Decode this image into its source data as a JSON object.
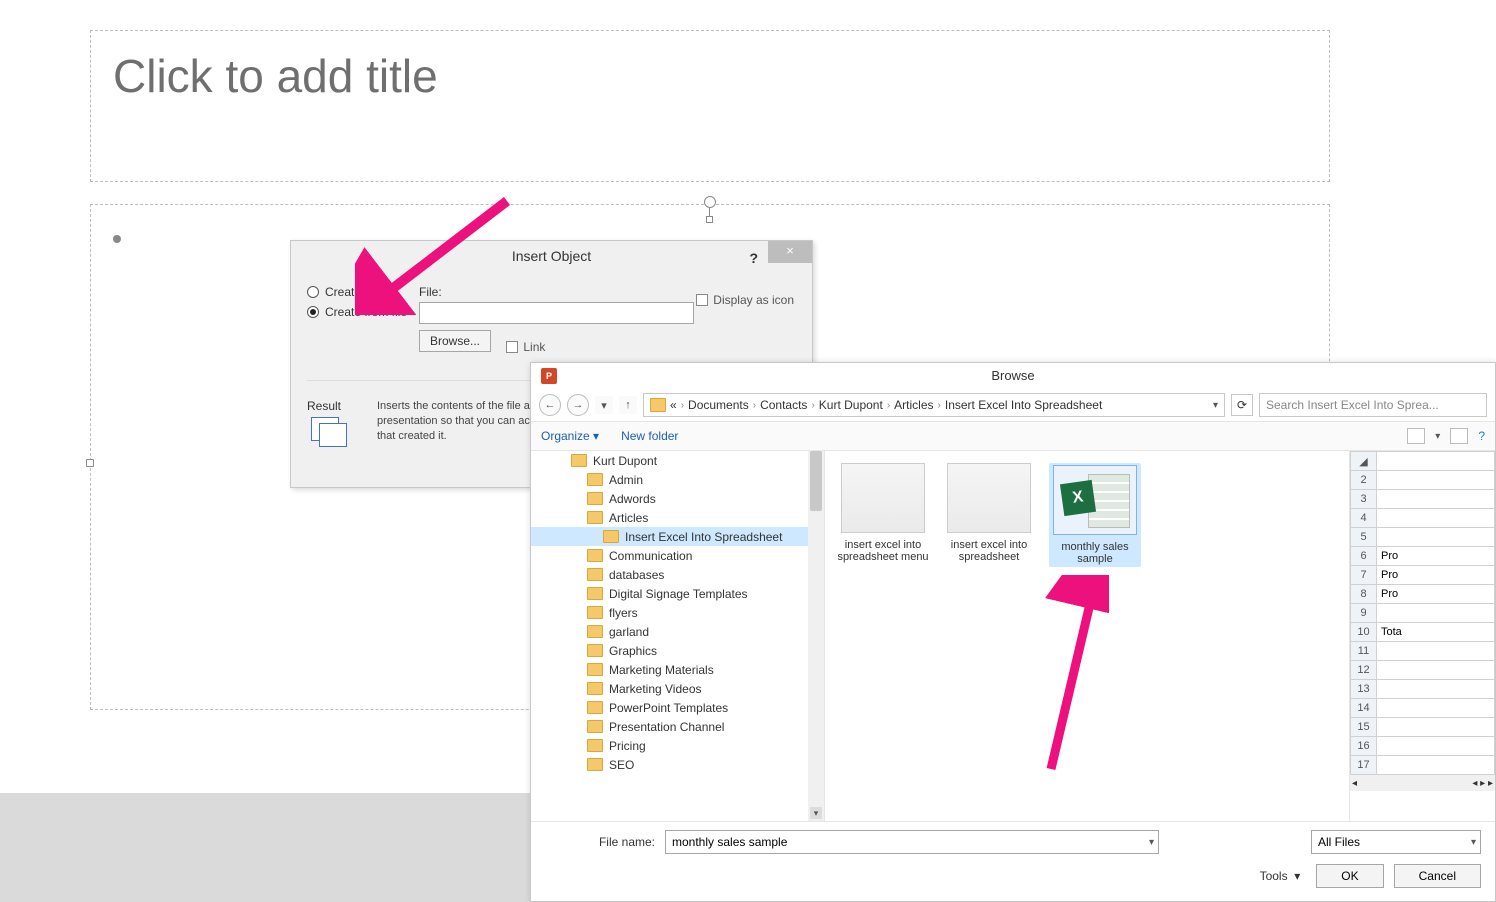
{
  "slide": {
    "title_placeholder": "Click to add title"
  },
  "insert_object": {
    "title": "Insert Object",
    "radio_new": "Create new",
    "radio_file": "Create from file",
    "file_label": "File:",
    "browse": "Browse...",
    "link": "Link",
    "display_icon": "Display as icon",
    "result_label": "Result",
    "result_desc": "Inserts the contents of the file as an object into your presentation so that you can activate it using the application that created it.",
    "help": "?",
    "close": "×"
  },
  "browse": {
    "title": "Browse",
    "ppt_badge": "P",
    "breadcrumb": [
      "«",
      "Documents",
      "Contacts",
      "Kurt Dupont",
      "Articles",
      "Insert Excel Into Spreadsheet"
    ],
    "search_placeholder": "Search Insert Excel Into Sprea...",
    "organize": "Organize",
    "new_folder": "New folder",
    "tree": [
      {
        "label": "Kurt Dupont",
        "indent": 40
      },
      {
        "label": "Admin",
        "indent": 56
      },
      {
        "label": "Adwords",
        "indent": 56
      },
      {
        "label": "Articles",
        "indent": 56
      },
      {
        "label": "Insert Excel Into Spreadsheet",
        "indent": 72,
        "selected": true
      },
      {
        "label": "Communication",
        "indent": 56
      },
      {
        "label": "databases",
        "indent": 56
      },
      {
        "label": "Digital Signage Templates",
        "indent": 56
      },
      {
        "label": "flyers",
        "indent": 56
      },
      {
        "label": "garland",
        "indent": 56
      },
      {
        "label": "Graphics",
        "indent": 56
      },
      {
        "label": "Marketing Materials",
        "indent": 56
      },
      {
        "label": "Marketing Videos",
        "indent": 56
      },
      {
        "label": "PowerPoint Templates",
        "indent": 56
      },
      {
        "label": "Presentation Channel",
        "indent": 56
      },
      {
        "label": "Pricing",
        "indent": 56
      },
      {
        "label": "SEO",
        "indent": 56
      }
    ],
    "files": [
      {
        "name": "insert excel into spreadsheet menu",
        "type": "img"
      },
      {
        "name": "insert excel into spreadsheet",
        "type": "img"
      },
      {
        "name": "monthly sales sample",
        "type": "xls",
        "selected": true
      }
    ],
    "preview_rows": [
      {
        "n": 2,
        "t": ""
      },
      {
        "n": 3,
        "t": ""
      },
      {
        "n": 4,
        "t": ""
      },
      {
        "n": 5,
        "t": ""
      },
      {
        "n": 6,
        "t": "Pro"
      },
      {
        "n": 7,
        "t": "Pro"
      },
      {
        "n": 8,
        "t": "Pro"
      },
      {
        "n": 9,
        "t": ""
      },
      {
        "n": 10,
        "t": "Tota"
      },
      {
        "n": 11,
        "t": ""
      },
      {
        "n": 12,
        "t": ""
      },
      {
        "n": 13,
        "t": ""
      },
      {
        "n": 14,
        "t": ""
      },
      {
        "n": 15,
        "t": ""
      },
      {
        "n": 16,
        "t": ""
      },
      {
        "n": 17,
        "t": ""
      }
    ],
    "filename_label": "File name:",
    "filename_value": "monthly sales sample",
    "filter": "All Files",
    "tools": "Tools",
    "ok": "OK",
    "cancel": "Cancel"
  }
}
